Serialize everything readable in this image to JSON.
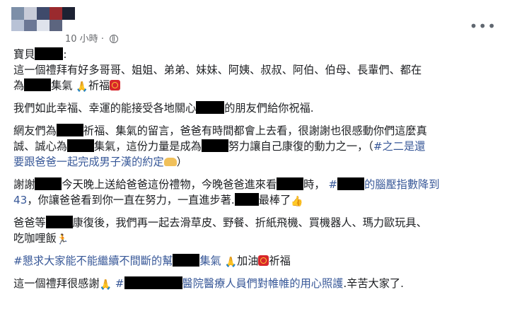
{
  "header": {
    "timestamp": "10 小時",
    "separator": "·",
    "privacy_icon": "globe-icon",
    "more_icon": "more-horizontal-icon"
  },
  "post": {
    "p1": {
      "greet": "寶貝",
      "colon": ":",
      "l2": "這一個禮拜有好多哥哥、姐姐、弟弟、妹妹、阿姨、叔叔、阿伯、伯母、長輩們、都在",
      "l3_a": "為",
      "l3_b": "集氣",
      "l3_c": "祈福"
    },
    "p2": {
      "a": "我們如此幸福、幸運的能接受各地關心",
      "b": "的朋友們給你祝福."
    },
    "p3": {
      "l1_a": "網友們為",
      "l1_b": "祈福、集氣的留言，爸爸有時間都會上去看，很謝謝也很感動你們這麼真",
      "l2_a": "誠、誠心為",
      "l2_b": "集氣，這份力量是成為",
      "l2_c": "努力讓自己康復的動力之一，（",
      "l2_link": "#之二是還",
      "l3_link": "要跟爸爸一起完成男子漢的約定",
      "l3_end": "）"
    },
    "p4": {
      "l1_a": "謝謝",
      "l1_b": "今天晚上送給爸爸這份禮物，今晚爸爸進來看",
      "l1_c": "時，",
      "l1_link_a": "#",
      "l1_link_b": "的腦壓指數降到",
      "l2_link": "43",
      "l2_a": "，你讓爸爸看到你一直在努力，一直進步著.",
      "l2_b": "最棒了"
    },
    "p5": {
      "l1_a": "爸爸等",
      "l1_b": "康復後，我們再一起去滑草皮、野餐、折紙飛機、買機器人、瑪力歐玩具、",
      "l2": "吃咖哩飯"
    },
    "p6": {
      "link_a": "#懇求大家能不能繼續不間斷的幫",
      "link_b": "集氣",
      "a": "加油",
      "b": "祈福"
    },
    "p7": {
      "a": "這一個禮拜很感謝",
      "link_a": "#",
      "link_b": "醫院醫療人員們對帷帷的用心照護",
      "b": ".辛苦大家了."
    }
  },
  "colors": {
    "link": "#385898",
    "meta": "#65676b",
    "text": "#1c1e21",
    "redaction": "#000000"
  }
}
